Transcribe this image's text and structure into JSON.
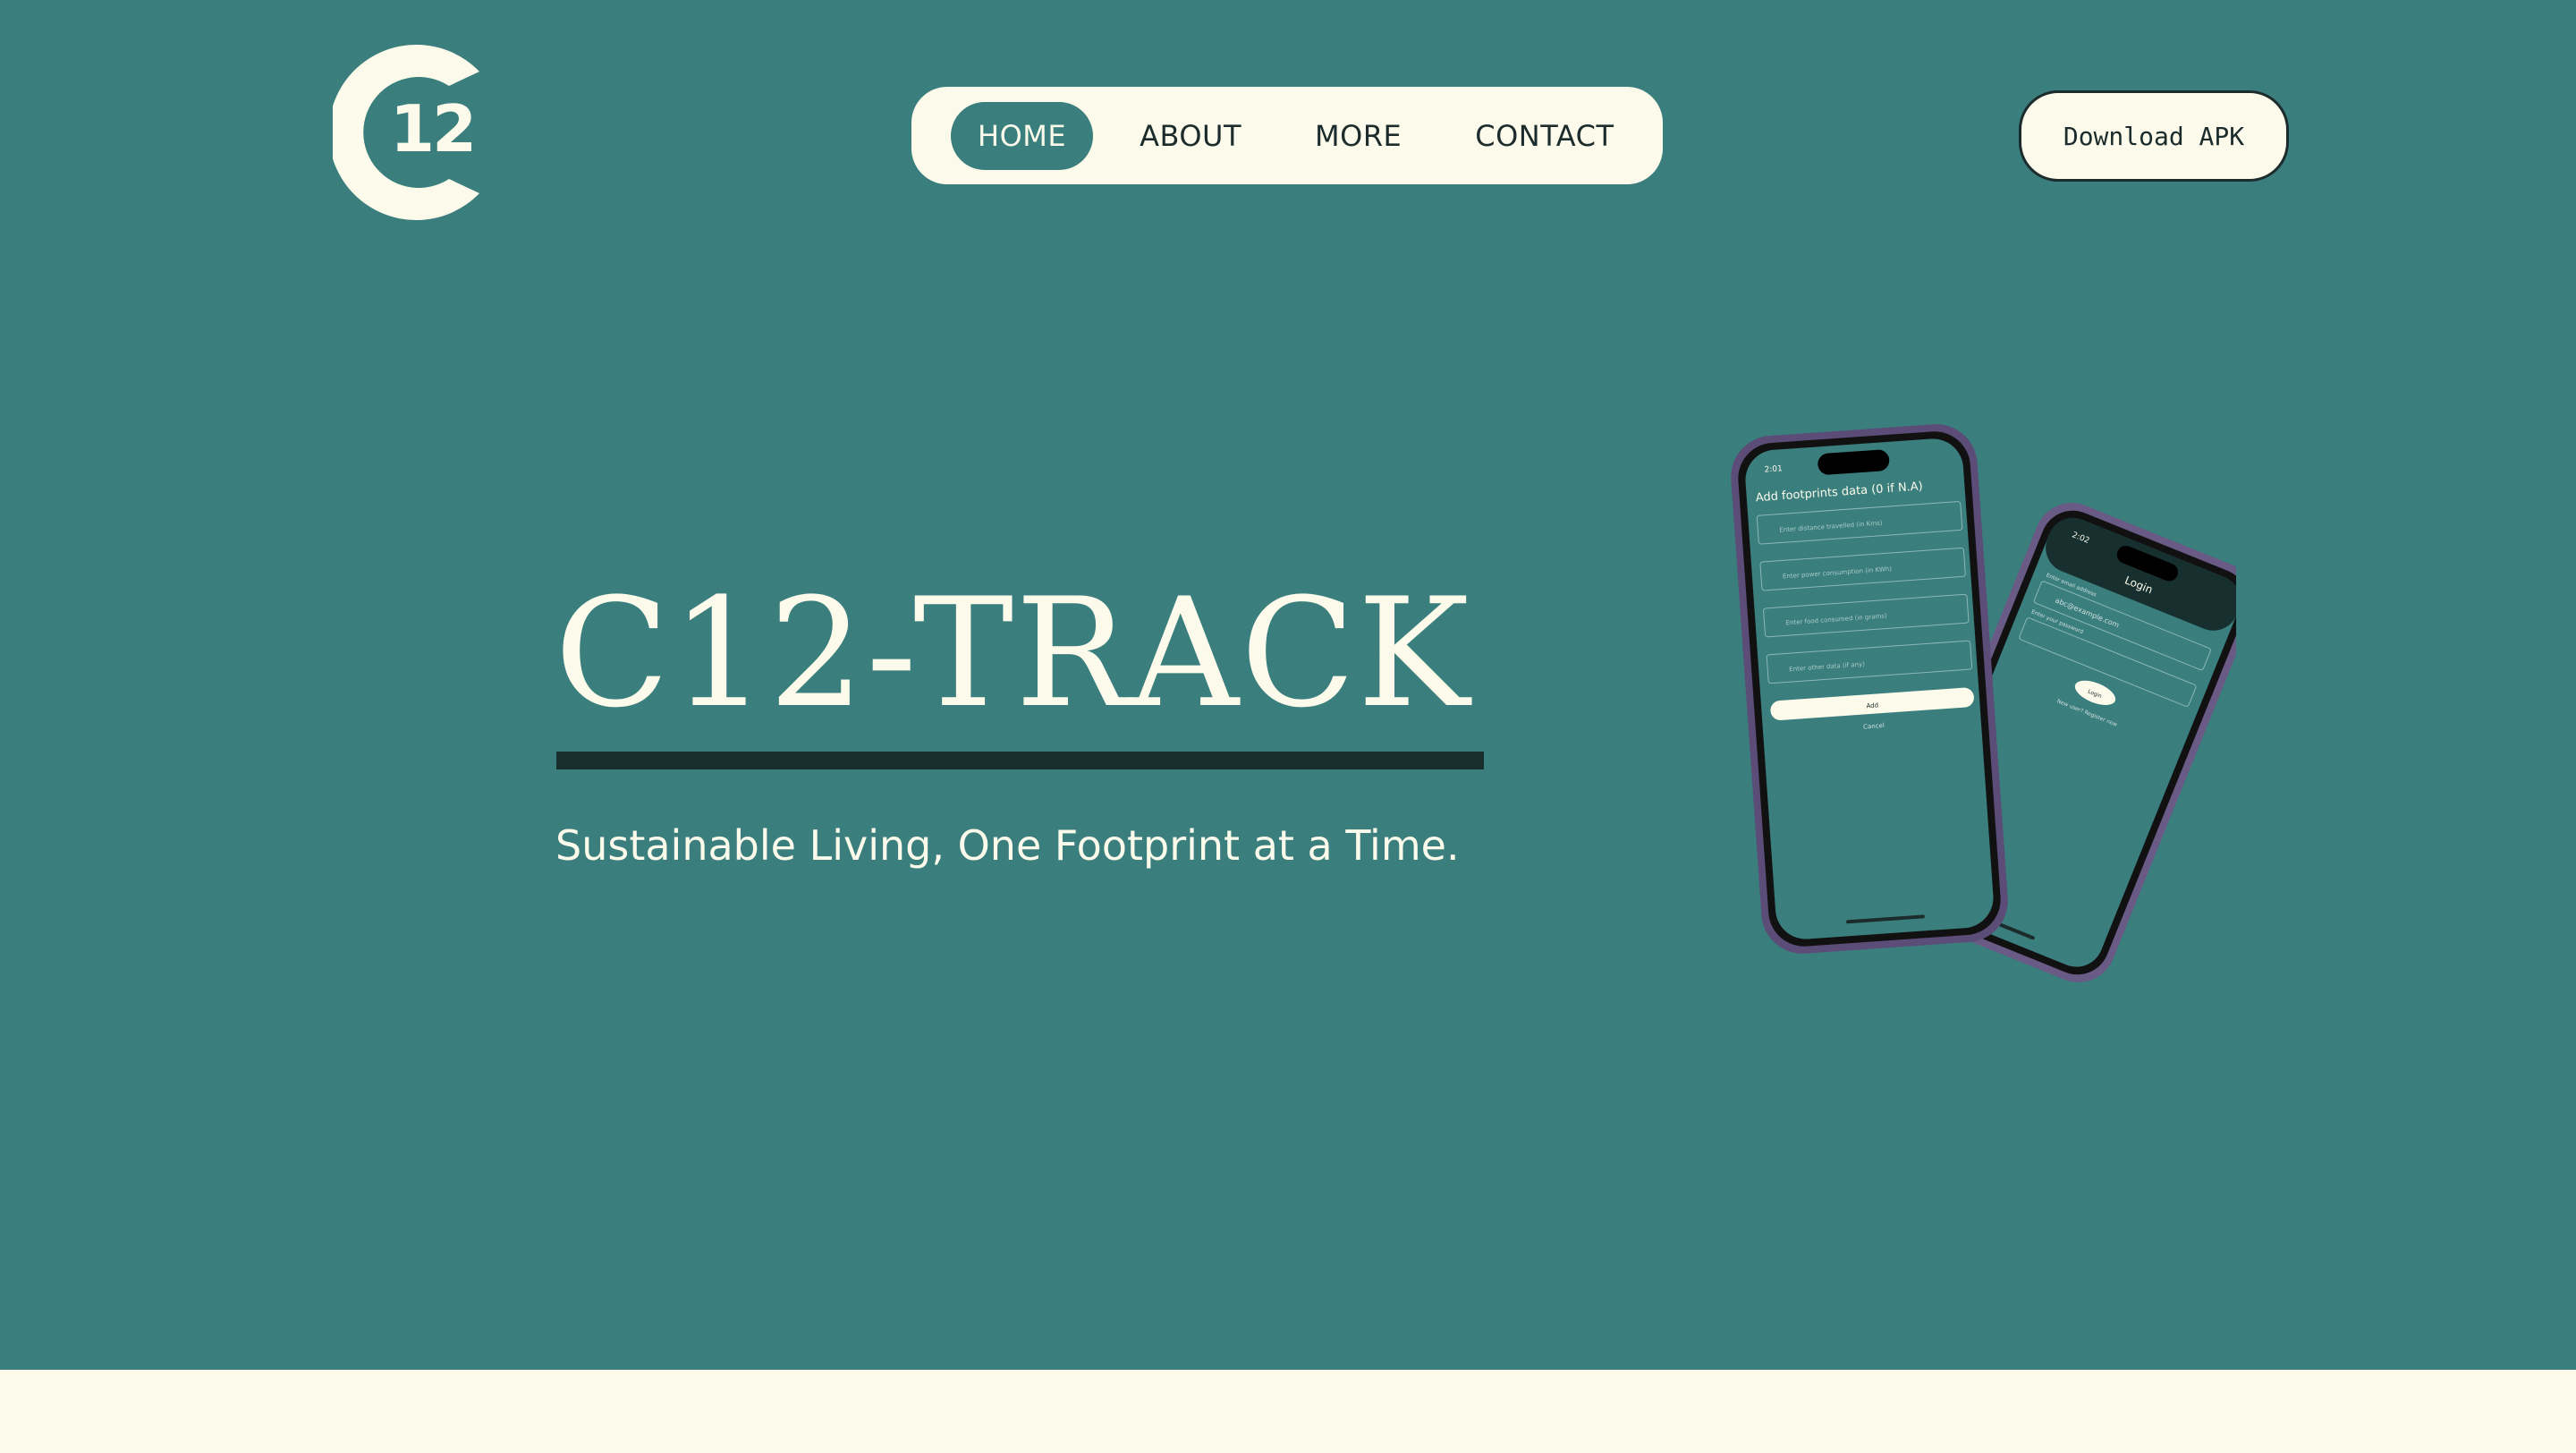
{
  "logo": {
    "text": "12"
  },
  "nav": {
    "items": [
      {
        "label": "HOME",
        "active": true
      },
      {
        "label": "ABOUT",
        "active": false
      },
      {
        "label": "MORE",
        "active": false
      },
      {
        "label": "CONTACT",
        "active": false
      }
    ]
  },
  "download_button": {
    "label": "Download APK"
  },
  "hero": {
    "title": "C12-TRACK",
    "subtitle": "Sustainable Living, One Footprint at a Time."
  },
  "phone_front": {
    "time": "2:01",
    "heading": "Add footprints data (0 if N.A)",
    "fields": [
      "Enter distance travelled (in Kms)",
      "Enter power consumption (in KWh)",
      "Enter food consumed (in grams)",
      "Enter other data (if any)"
    ],
    "add_label": "Add",
    "cancel_label": "Cancel"
  },
  "phone_back": {
    "time": "2:02",
    "heading": "Login",
    "email_label": "Enter email address",
    "email_value": "abc@example.com",
    "password_label": "Enter your password",
    "login_label": "Login",
    "register_text": "New user? Register now"
  },
  "colors": {
    "background": "#3a7e7d",
    "cream": "#fcfbeb",
    "dark": "#1c2b2b",
    "underline": "#182e2d"
  }
}
